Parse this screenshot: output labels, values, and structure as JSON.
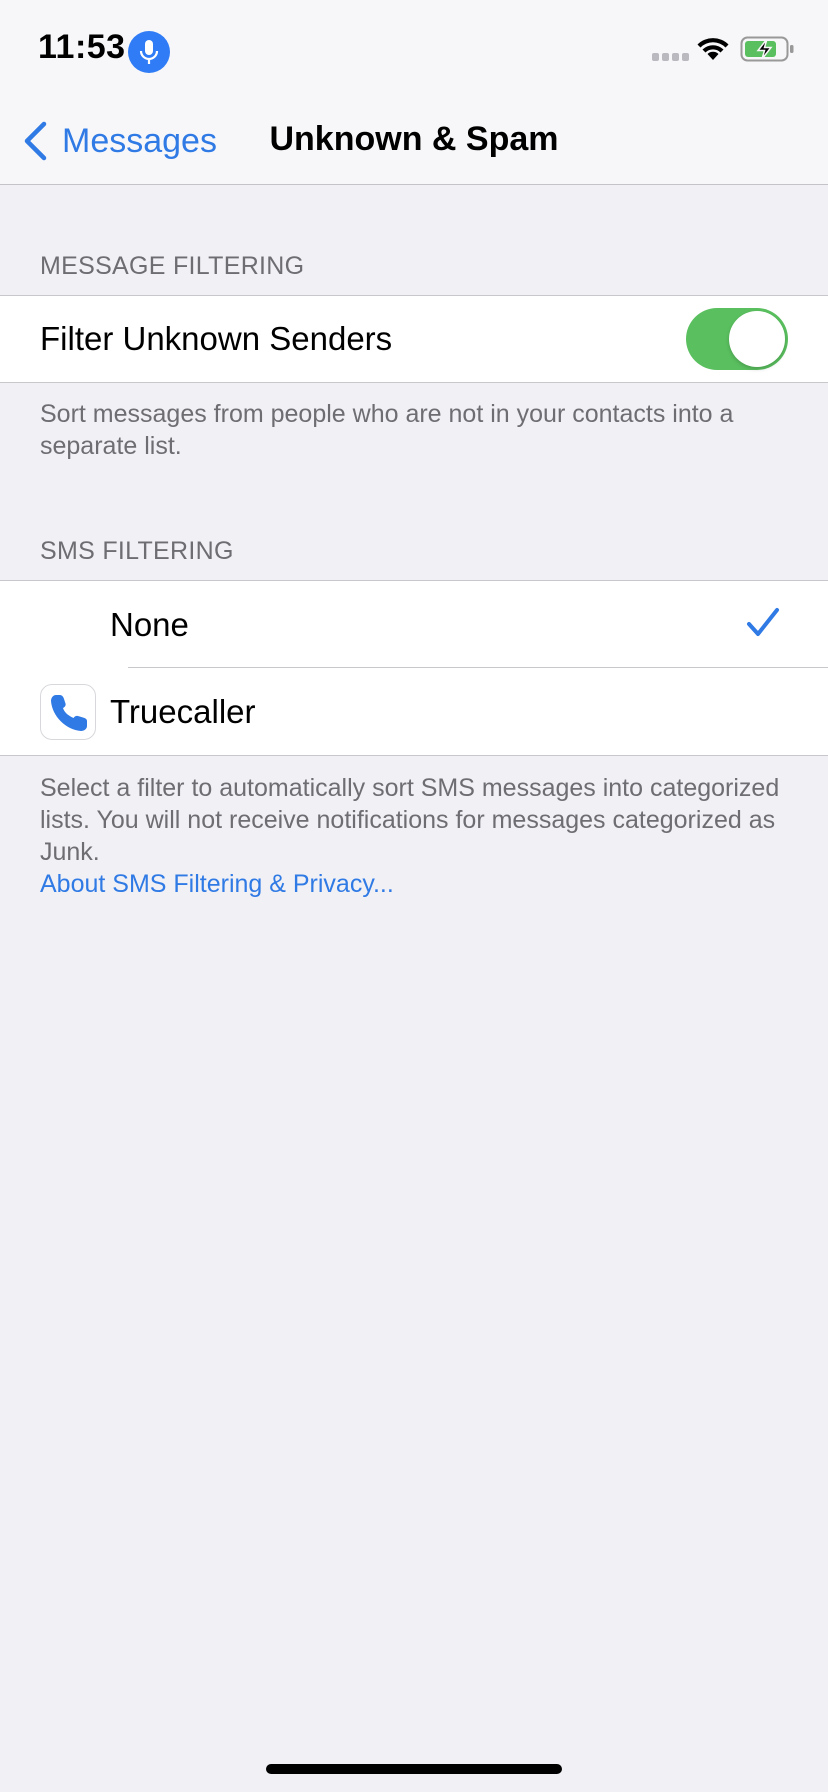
{
  "status_bar": {
    "time": "11:53",
    "icons": [
      "microphone-icon",
      "cellular-signal-icon",
      "wifi-icon",
      "battery-charging-icon"
    ]
  },
  "nav": {
    "back_label": "Messages",
    "title": "Unknown & Spam"
  },
  "message_filtering": {
    "header": "MESSAGE FILTERING",
    "filter_unknown_label": "Filter Unknown Senders",
    "filter_unknown_enabled": true,
    "footer": "Sort messages from people who are not in your contacts into a separate list."
  },
  "sms_filtering": {
    "header": "SMS FILTERING",
    "options": [
      {
        "label": "None",
        "selected": true,
        "icon": ""
      },
      {
        "label": "Truecaller",
        "selected": false,
        "icon": "phone-icon"
      }
    ],
    "footer": "Select a filter to automatically sort SMS messages into categorized lists. You will not receive notifications for messages categorized as Junk.",
    "footer_link": "About SMS Filtering & Privacy..."
  },
  "colors": {
    "accent": "#2f7ae5",
    "toggle_on": "#5ac05f",
    "background": "#f0f0f5",
    "secondary_text": "#6d6d72"
  }
}
